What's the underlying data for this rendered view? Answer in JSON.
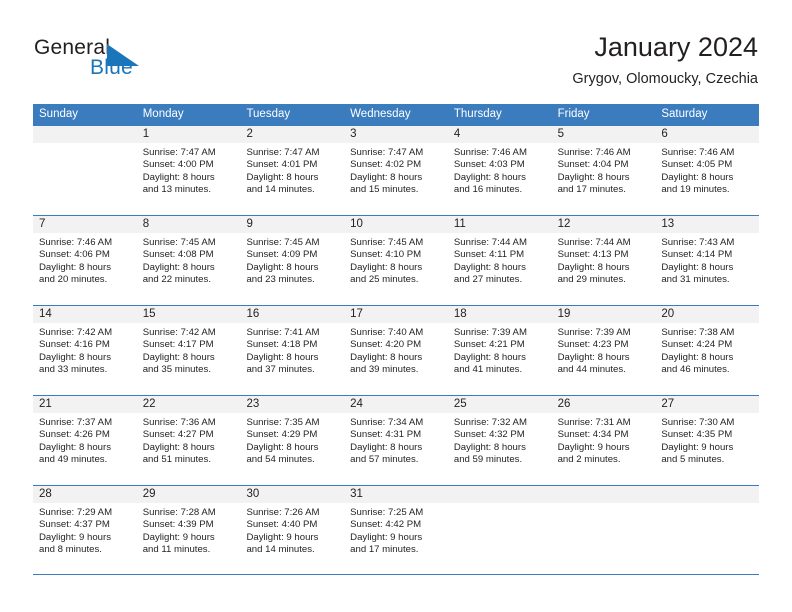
{
  "logo": {
    "word_general": "General",
    "word_blue": "Blue",
    "triangle_color": "#1b75bb"
  },
  "header": {
    "title": "January 2024",
    "subtitle": "Grygov, Olomoucky, Czechia"
  },
  "calendar": {
    "header_color": "#3b7cbf",
    "weekdays": [
      "Sunday",
      "Monday",
      "Tuesday",
      "Wednesday",
      "Thursday",
      "Friday",
      "Saturday"
    ],
    "weeks": [
      [
        {
          "day": "",
          "sunrise": "",
          "sunset": "",
          "daylight_line1": "",
          "daylight_line2": "",
          "empty": true
        },
        {
          "day": "1",
          "sunrise": "Sunrise: 7:47 AM",
          "sunset": "Sunset: 4:00 PM",
          "daylight_line1": "Daylight: 8 hours",
          "daylight_line2": "and 13 minutes."
        },
        {
          "day": "2",
          "sunrise": "Sunrise: 7:47 AM",
          "sunset": "Sunset: 4:01 PM",
          "daylight_line1": "Daylight: 8 hours",
          "daylight_line2": "and 14 minutes."
        },
        {
          "day": "3",
          "sunrise": "Sunrise: 7:47 AM",
          "sunset": "Sunset: 4:02 PM",
          "daylight_line1": "Daylight: 8 hours",
          "daylight_line2": "and 15 minutes."
        },
        {
          "day": "4",
          "sunrise": "Sunrise: 7:46 AM",
          "sunset": "Sunset: 4:03 PM",
          "daylight_line1": "Daylight: 8 hours",
          "daylight_line2": "and 16 minutes."
        },
        {
          "day": "5",
          "sunrise": "Sunrise: 7:46 AM",
          "sunset": "Sunset: 4:04 PM",
          "daylight_line1": "Daylight: 8 hours",
          "daylight_line2": "and 17 minutes."
        },
        {
          "day": "6",
          "sunrise": "Sunrise: 7:46 AM",
          "sunset": "Sunset: 4:05 PM",
          "daylight_line1": "Daylight: 8 hours",
          "daylight_line2": "and 19 minutes."
        }
      ],
      [
        {
          "day": "7",
          "sunrise": "Sunrise: 7:46 AM",
          "sunset": "Sunset: 4:06 PM",
          "daylight_line1": "Daylight: 8 hours",
          "daylight_line2": "and 20 minutes."
        },
        {
          "day": "8",
          "sunrise": "Sunrise: 7:45 AM",
          "sunset": "Sunset: 4:08 PM",
          "daylight_line1": "Daylight: 8 hours",
          "daylight_line2": "and 22 minutes."
        },
        {
          "day": "9",
          "sunrise": "Sunrise: 7:45 AM",
          "sunset": "Sunset: 4:09 PM",
          "daylight_line1": "Daylight: 8 hours",
          "daylight_line2": "and 23 minutes."
        },
        {
          "day": "10",
          "sunrise": "Sunrise: 7:45 AM",
          "sunset": "Sunset: 4:10 PM",
          "daylight_line1": "Daylight: 8 hours",
          "daylight_line2": "and 25 minutes."
        },
        {
          "day": "11",
          "sunrise": "Sunrise: 7:44 AM",
          "sunset": "Sunset: 4:11 PM",
          "daylight_line1": "Daylight: 8 hours",
          "daylight_line2": "and 27 minutes."
        },
        {
          "day": "12",
          "sunrise": "Sunrise: 7:44 AM",
          "sunset": "Sunset: 4:13 PM",
          "daylight_line1": "Daylight: 8 hours",
          "daylight_line2": "and 29 minutes."
        },
        {
          "day": "13",
          "sunrise": "Sunrise: 7:43 AM",
          "sunset": "Sunset: 4:14 PM",
          "daylight_line1": "Daylight: 8 hours",
          "daylight_line2": "and 31 minutes."
        }
      ],
      [
        {
          "day": "14",
          "sunrise": "Sunrise: 7:42 AM",
          "sunset": "Sunset: 4:16 PM",
          "daylight_line1": "Daylight: 8 hours",
          "daylight_line2": "and 33 minutes."
        },
        {
          "day": "15",
          "sunrise": "Sunrise: 7:42 AM",
          "sunset": "Sunset: 4:17 PM",
          "daylight_line1": "Daylight: 8 hours",
          "daylight_line2": "and 35 minutes."
        },
        {
          "day": "16",
          "sunrise": "Sunrise: 7:41 AM",
          "sunset": "Sunset: 4:18 PM",
          "daylight_line1": "Daylight: 8 hours",
          "daylight_line2": "and 37 minutes."
        },
        {
          "day": "17",
          "sunrise": "Sunrise: 7:40 AM",
          "sunset": "Sunset: 4:20 PM",
          "daylight_line1": "Daylight: 8 hours",
          "daylight_line2": "and 39 minutes."
        },
        {
          "day": "18",
          "sunrise": "Sunrise: 7:39 AM",
          "sunset": "Sunset: 4:21 PM",
          "daylight_line1": "Daylight: 8 hours",
          "daylight_line2": "and 41 minutes."
        },
        {
          "day": "19",
          "sunrise": "Sunrise: 7:39 AM",
          "sunset": "Sunset: 4:23 PM",
          "daylight_line1": "Daylight: 8 hours",
          "daylight_line2": "and 44 minutes."
        },
        {
          "day": "20",
          "sunrise": "Sunrise: 7:38 AM",
          "sunset": "Sunset: 4:24 PM",
          "daylight_line1": "Daylight: 8 hours",
          "daylight_line2": "and 46 minutes."
        }
      ],
      [
        {
          "day": "21",
          "sunrise": "Sunrise: 7:37 AM",
          "sunset": "Sunset: 4:26 PM",
          "daylight_line1": "Daylight: 8 hours",
          "daylight_line2": "and 49 minutes."
        },
        {
          "day": "22",
          "sunrise": "Sunrise: 7:36 AM",
          "sunset": "Sunset: 4:27 PM",
          "daylight_line1": "Daylight: 8 hours",
          "daylight_line2": "and 51 minutes."
        },
        {
          "day": "23",
          "sunrise": "Sunrise: 7:35 AM",
          "sunset": "Sunset: 4:29 PM",
          "daylight_line1": "Daylight: 8 hours",
          "daylight_line2": "and 54 minutes."
        },
        {
          "day": "24",
          "sunrise": "Sunrise: 7:34 AM",
          "sunset": "Sunset: 4:31 PM",
          "daylight_line1": "Daylight: 8 hours",
          "daylight_line2": "and 57 minutes."
        },
        {
          "day": "25",
          "sunrise": "Sunrise: 7:32 AM",
          "sunset": "Sunset: 4:32 PM",
          "daylight_line1": "Daylight: 8 hours",
          "daylight_line2": "and 59 minutes."
        },
        {
          "day": "26",
          "sunrise": "Sunrise: 7:31 AM",
          "sunset": "Sunset: 4:34 PM",
          "daylight_line1": "Daylight: 9 hours",
          "daylight_line2": "and 2 minutes."
        },
        {
          "day": "27",
          "sunrise": "Sunrise: 7:30 AM",
          "sunset": "Sunset: 4:35 PM",
          "daylight_line1": "Daylight: 9 hours",
          "daylight_line2": "and 5 minutes."
        }
      ],
      [
        {
          "day": "28",
          "sunrise": "Sunrise: 7:29 AM",
          "sunset": "Sunset: 4:37 PM",
          "daylight_line1": "Daylight: 9 hours",
          "daylight_line2": "and 8 minutes."
        },
        {
          "day": "29",
          "sunrise": "Sunrise: 7:28 AM",
          "sunset": "Sunset: 4:39 PM",
          "daylight_line1": "Daylight: 9 hours",
          "daylight_line2": "and 11 minutes."
        },
        {
          "day": "30",
          "sunrise": "Sunrise: 7:26 AM",
          "sunset": "Sunset: 4:40 PM",
          "daylight_line1": "Daylight: 9 hours",
          "daylight_line2": "and 14 minutes."
        },
        {
          "day": "31",
          "sunrise": "Sunrise: 7:25 AM",
          "sunset": "Sunset: 4:42 PM",
          "daylight_line1": "Daylight: 9 hours",
          "daylight_line2": "and 17 minutes."
        },
        {
          "day": "",
          "sunrise": "",
          "sunset": "",
          "daylight_line1": "",
          "daylight_line2": "",
          "empty": true
        },
        {
          "day": "",
          "sunrise": "",
          "sunset": "",
          "daylight_line1": "",
          "daylight_line2": "",
          "empty": true
        },
        {
          "day": "",
          "sunrise": "",
          "sunset": "",
          "daylight_line1": "",
          "daylight_line2": "",
          "empty": true
        }
      ]
    ]
  }
}
